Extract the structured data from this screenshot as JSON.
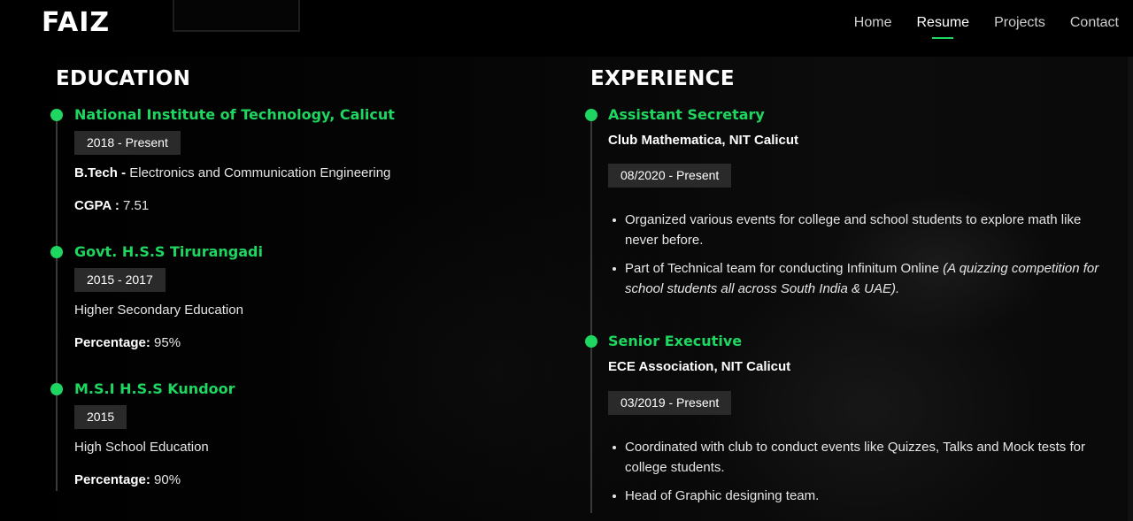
{
  "brand": "FAIZ",
  "nav": {
    "items": [
      {
        "label": "Home"
      },
      {
        "label": "Resume"
      },
      {
        "label": "Projects"
      },
      {
        "label": "Contact"
      }
    ],
    "active": "Resume"
  },
  "education": {
    "title": "EDUCATION",
    "items": [
      {
        "school": "National Institute of Technology, Calicut",
        "date": "2018 - Present",
        "line1_label": "B.Tech - ",
        "line1_value": "Electronics and Communication Engineering",
        "line2_label": "CGPA : ",
        "line2_value": "7.51"
      },
      {
        "school": "Govt. H.S.S Tirurangadi",
        "date": "2015 - 2017",
        "line1_value": "Higher Secondary Education",
        "line2_label": "Percentage: ",
        "line2_value": "95%"
      },
      {
        "school": "M.S.I H.S.S Kundoor",
        "date": "2015",
        "line1_value": "High School Education",
        "line2_label": "Percentage: ",
        "line2_value": "90%"
      }
    ]
  },
  "experience": {
    "title": "EXPERIENCE",
    "items": [
      {
        "role": "Assistant Secretary",
        "org": "Club Mathematica, NIT Calicut",
        "date": "08/2020 - Present",
        "bullets": [
          {
            "text": "Organized various events for college and school students to explore math like never before."
          },
          {
            "text": "Part of Technical team for conducting Infinitum Online ",
            "italic": "(A quizzing competition for school students all across South India & UAE)."
          }
        ]
      },
      {
        "role": "Senior Executive",
        "org": "ECE Association, NIT Calicut",
        "date": "03/2019 - Present",
        "bullets": [
          {
            "text": "Coordinated with club to conduct events like Quizzes, Talks and Mock tests for college students."
          },
          {
            "text": "Head of Graphic designing team."
          }
        ]
      }
    ]
  },
  "colors": {
    "accent": "#1ed760",
    "background": "#000000",
    "chip": "#2a2a2a"
  }
}
